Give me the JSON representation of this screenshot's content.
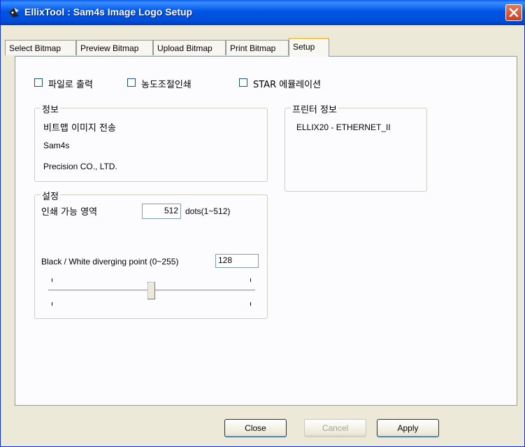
{
  "window": {
    "title": "EllixTool : Sam4s Image Logo Setup"
  },
  "tabs": [
    {
      "label": "Select Bitmap"
    },
    {
      "label": "Preview Bitmap"
    },
    {
      "label": "Upload Bitmap"
    },
    {
      "label": "Print Bitmap"
    },
    {
      "label": "Setup",
      "active": true
    }
  ],
  "options": {
    "file_output": {
      "label": "파일로 출력",
      "checked": false
    },
    "density_print": {
      "label": "농도조절인쇄",
      "checked": false
    },
    "star_emulation": {
      "label": "STAR 에뮬레이션",
      "checked": false
    }
  },
  "info": {
    "legend": "정보",
    "line1": "비트맵 이미지 전송",
    "line2": "Sam4s",
    "line3": "Precision CO., LTD."
  },
  "printer_info": {
    "legend": "프린터 정보",
    "value": "ELLIX20 - ETHERNET_II"
  },
  "settings": {
    "legend": "설정",
    "print_area_label": "인쇄 가능 영역",
    "print_area_value": "512",
    "print_area_unit": "dots(1~512)",
    "bw_label": "Black / White diverging point (0~255)",
    "bw_value": "128",
    "slider_value": 128,
    "slider_min": 0,
    "slider_max": 255
  },
  "buttons": {
    "close": "Close",
    "cancel": "Cancel",
    "apply": "Apply"
  },
  "colors": {
    "titlebar": "#0055e5",
    "window_bg": "#ece9d8",
    "tab_highlight": "#ffc83c",
    "panel_bg": "#fcfcfe"
  }
}
